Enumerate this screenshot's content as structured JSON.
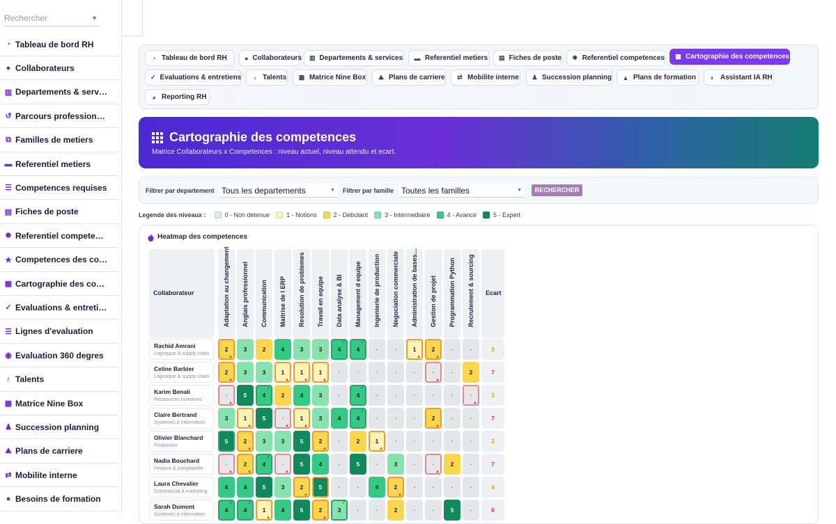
{
  "sidebar": {
    "search_placeholder": "Rechercher",
    "items": [
      {
        "label": "Tableau de bord RH",
        "icon": "dashboard-icon"
      },
      {
        "label": "Collaborateurs",
        "icon": "user-icon"
      },
      {
        "label": "Departements & serv…",
        "icon": "building-icon"
      },
      {
        "label": "Parcours profession…",
        "icon": "history-icon"
      },
      {
        "label": "Familles de metiers",
        "icon": "sitemap-icon"
      },
      {
        "label": "Referentiel metiers",
        "icon": "briefcase-icon"
      },
      {
        "label": "Competences requises",
        "icon": "list-icon"
      },
      {
        "label": "Fiches de poste",
        "icon": "file-icon"
      },
      {
        "label": "Referentiel compete…",
        "icon": "gear-icon"
      },
      {
        "label": "Competences des co…",
        "icon": "star-icon"
      },
      {
        "label": "Cartographie des co…",
        "icon": "grid-icon"
      },
      {
        "label": "Evaluations & entreti…",
        "icon": "clipboard-check-icon"
      },
      {
        "label": "Lignes d'evaluation",
        "icon": "list-icon"
      },
      {
        "label": "Evaluation 360 degres",
        "icon": "comments-icon"
      },
      {
        "label": "Talents",
        "icon": "award-icon"
      },
      {
        "label": "Matrice Nine Box",
        "icon": "grid-icon"
      },
      {
        "label": "Succession planning",
        "icon": "user-tie-icon"
      },
      {
        "label": "Plans de carriere",
        "icon": "road-icon"
      },
      {
        "label": "Mobilite interne",
        "icon": "exchange-icon"
      },
      {
        "label": "Besoins de formation",
        "icon": "lightbulb-icon"
      }
    ]
  },
  "tabs": [
    {
      "label": "Tableau de bord RH",
      "icon": "dashboard-icon",
      "active": false
    },
    {
      "label": "Collaborateurs",
      "icon": "user-icon",
      "active": false
    },
    {
      "label": "Departements & services",
      "icon": "building-icon",
      "active": false
    },
    {
      "label": "Referentiel metiers",
      "icon": "briefcase-icon",
      "active": false
    },
    {
      "label": "Fiches de poste",
      "icon": "file-icon",
      "active": false
    },
    {
      "label": "Referentiel competences",
      "icon": "gear-icon",
      "active": false
    },
    {
      "label": "Cartographie des competences",
      "icon": "grid-icon",
      "active": true
    },
    {
      "label": "Evaluations & entretiens",
      "icon": "clipboard-check-icon",
      "active": false
    },
    {
      "label": "Talents",
      "icon": "award-icon",
      "active": false
    },
    {
      "label": "Matrice Nine Box",
      "icon": "grid-icon",
      "active": false
    },
    {
      "label": "Plans de carriere",
      "icon": "road-icon",
      "active": false
    },
    {
      "label": "Mobilite interne",
      "icon": "exchange-icon",
      "active": false
    },
    {
      "label": "Succession planning",
      "icon": "user-tie-icon",
      "active": false
    },
    {
      "label": "Plans de formation",
      "icon": "graduation-cap-icon",
      "active": false
    },
    {
      "label": "Assistant IA RH",
      "icon": "brain-icon",
      "active": false
    },
    {
      "label": "Reporting RH",
      "icon": "chart-pie-icon",
      "active": false
    }
  ],
  "banner": {
    "title": "Cartographie des competences",
    "subtitle": "Matrice Collaborateurs x Competences : niveau actuel, niveau attendu et ecart.",
    "icon": "grid-icon"
  },
  "filters": {
    "department_label": "Filtrer par departement",
    "department_value": "Tous les departements",
    "family_label": "Filtrer par famille",
    "family_value": "Toutes les familles",
    "search_button": "RECHERCHER"
  },
  "legend": {
    "title": "Legende des niveaux :",
    "levels": [
      {
        "label": "0 - Non detenue",
        "color": "#e4e6ea"
      },
      {
        "label": "1 - Notions",
        "color": "#fff3b8"
      },
      {
        "label": "2 - Debutant",
        "color": "#fcd74e"
      },
      {
        "label": "3 - Intermediaire",
        "color": "#86e3ad"
      },
      {
        "label": "4 - Avance",
        "color": "#35c986"
      },
      {
        "label": "5 - Expert",
        "color": "#0f8b5b"
      }
    ]
  },
  "heatmap": {
    "title": "Heatmap des competences",
    "icon": "fire-icon",
    "collab_header": "Collaborateur",
    "ecart_header": "Ecart",
    "skills": [
      "Adaptation au changement",
      "Anglais professionnel",
      "Communication",
      "Maitrise de l ERP",
      "Resolution de problemes",
      "Travail en equipe",
      "Data analyse & BI",
      "Management d equipe",
      "Ingenierie de production",
      "Negociation commerciale",
      "Administration de bases de donnees",
      "Gestion de projet",
      "Programmation Python",
      "Recrutement & sourcing"
    ],
    "rows": [
      {
        "name": "Rachid Amrani",
        "dept": "Logistique & supply chain",
        "cells": [
          "2",
          "3",
          "2",
          "4",
          "3",
          "3",
          "4",
          "4",
          "·",
          "·",
          "1",
          "2",
          "·",
          "·"
        ],
        "status": [
          "gap",
          "",
          "",
          "",
          "",
          "",
          "ok",
          "ok",
          "",
          "",
          "gap",
          "gap",
          "",
          ""
        ],
        "ecart": "3",
        "ecart_color": "#e0a100"
      },
      {
        "name": "Celine Barbier",
        "dept": "Logistique & supply chain",
        "cells": [
          "2",
          "3",
          "3",
          "1",
          "1",
          "1",
          "·",
          "·",
          "·",
          "·",
          "·",
          "·",
          "·",
          "2"
        ],
        "status": [
          "gap",
          "",
          "",
          "gap",
          "gap",
          "gap",
          "",
          "",
          "",
          "",
          "",
          "gap",
          "",
          ""
        ],
        "ecart": "7",
        "ecart_color": "#d63a3a"
      },
      {
        "name": "Karim Benali",
        "dept": "Ressources humaines",
        "cells": [
          "·",
          "5",
          "4",
          "2",
          "4",
          "3",
          "·",
          "4",
          "·",
          "·",
          "·",
          "·",
          "·",
          "·"
        ],
        "status": [
          "gap",
          "",
          "ok",
          "",
          "",
          "",
          "",
          "ok",
          "",
          "",
          "",
          "",
          "",
          "gap"
        ],
        "ecart": "3",
        "ecart_color": "#e0a100"
      },
      {
        "name": "Claire Bertrand",
        "dept": "Systemes d information",
        "cells": [
          "3",
          "1",
          "5",
          "·",
          "1",
          "3",
          "4",
          "4",
          "·",
          "·",
          "·",
          "2",
          "·",
          "·"
        ],
        "status": [
          "",
          "gap",
          "",
          "gap",
          "gap",
          "",
          "",
          "ok",
          "",
          "",
          "",
          "gap",
          "",
          ""
        ],
        "ecart": "7",
        "ecart_color": "#d63a3a"
      },
      {
        "name": "Olivier Blanchard",
        "dept": "Production",
        "cells": [
          "5",
          "2",
          "3",
          "3",
          "5",
          "2",
          "·",
          "2",
          "1",
          "·",
          "·",
          "·",
          "·",
          "·"
        ],
        "status": [
          "ok",
          "gap",
          "",
          "",
          "",
          "gap",
          "",
          "",
          "gap",
          "",
          "",
          "",
          "",
          ""
        ],
        "ecart": "3",
        "ecart_color": "#e0a100"
      },
      {
        "name": "Nadia Bouchard",
        "dept": "Finance & comptabilite",
        "cells": [
          "·",
          "2",
          "4",
          "·",
          "5",
          "4",
          "·",
          "5",
          "·",
          "3",
          "·",
          "·",
          "2",
          "·"
        ],
        "status": [
          "gap",
          "gap",
          "ok",
          "gap",
          "",
          "",
          "",
          "",
          "",
          "",
          "",
          "gap",
          "",
          ""
        ],
        "ecart": "7",
        "ecart_color": "#d63a3a"
      },
      {
        "name": "Laura Chevalier",
        "dept": "Commercial & marketing",
        "cells": [
          "4",
          "4",
          "5",
          "3",
          "2",
          "5",
          "·",
          "·",
          "4",
          "2",
          "·",
          "·",
          "·",
          "·"
        ],
        "status": [
          "",
          "",
          "",
          "",
          "gap",
          "gap",
          "",
          "",
          "",
          "gap",
          "",
          "",
          "",
          ""
        ],
        "ecart": "4",
        "ecart_color": "#e0a100"
      },
      {
        "name": "Sarah Dumont",
        "dept": "Systemes d information",
        "cells": [
          "4",
          "4",
          "1",
          "4",
          "5",
          "2",
          "3",
          "·",
          "·",
          "2",
          "·",
          "·",
          "5",
          "·"
        ],
        "status": [
          "ok",
          "ok",
          "gap",
          "",
          "",
          "gap",
          "ok",
          "",
          "",
          "",
          "",
          "",
          "",
          ""
        ],
        "ecart": "6",
        "ecart_color": "#d63a3a"
      }
    ]
  }
}
